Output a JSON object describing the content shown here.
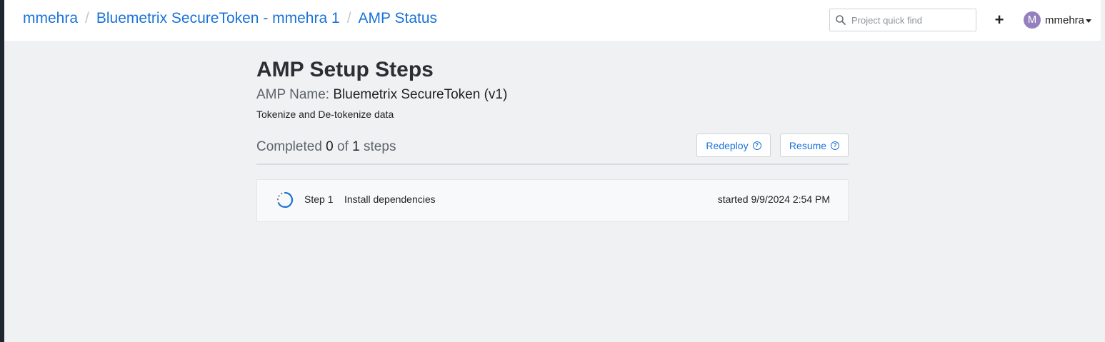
{
  "breadcrumb": {
    "items": [
      "mmehra",
      "Bluemetrix SecureToken - mmehra 1",
      "AMP Status"
    ],
    "separator": "/"
  },
  "header": {
    "search_placeholder": "Project quick find",
    "plus_label": "+",
    "user_initial": "M",
    "username": "mmehra"
  },
  "main": {
    "title": "AMP Setup Steps",
    "amp_name_label": "AMP Name:",
    "amp_name_value": "Bluemetrix SecureToken (v1)",
    "description": "Tokenize and De-tokenize data",
    "progress": {
      "prefix": "Completed",
      "completed": "0",
      "of": "of",
      "total": "1",
      "suffix": "steps"
    },
    "buttons": {
      "redeploy": "Redeploy",
      "resume": "Resume"
    },
    "steps": [
      {
        "number": "Step 1",
        "label": "Install dependencies",
        "status": "started 9/9/2024 2:54 PM"
      }
    ]
  },
  "colors": {
    "link": "#1a73d9",
    "avatar": "#9580bf",
    "page_bg": "#eff1f3",
    "spinner": "#1a73d9"
  },
  "icons": {
    "search": "search-icon",
    "help": "help-circle-icon",
    "spinner": "loading-spinner-icon",
    "caret": "caret-down-icon"
  }
}
